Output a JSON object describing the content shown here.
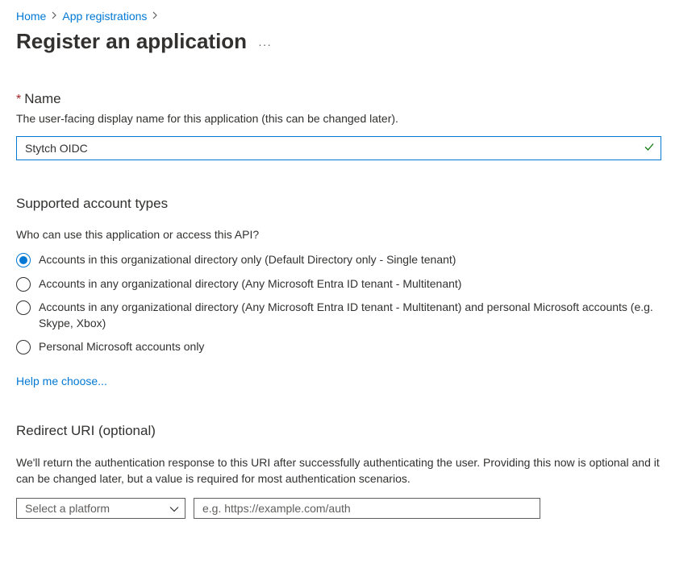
{
  "breadcrumb": {
    "items": [
      "Home",
      "App registrations"
    ]
  },
  "header": {
    "title": "Register an application"
  },
  "name_section": {
    "label": "Name",
    "hint": "The user-facing display name for this application (this can be changed later).",
    "value": "Stytch OIDC"
  },
  "account_types": {
    "heading": "Supported account types",
    "question": "Who can use this application or access this API?",
    "options": [
      "Accounts in this organizational directory only (Default Directory only - Single tenant)",
      "Accounts in any organizational directory (Any Microsoft Entra ID tenant - Multitenant)",
      "Accounts in any organizational directory (Any Microsoft Entra ID tenant - Multitenant) and personal Microsoft accounts (e.g. Skype, Xbox)",
      "Personal Microsoft accounts only"
    ],
    "selected_index": 0,
    "help_link": "Help me choose..."
  },
  "redirect": {
    "heading": "Redirect URI (optional)",
    "description": "We'll return the authentication response to this URI after successfully authenticating the user. Providing this now is optional and it can be changed later, but a value is required for most authentication scenarios.",
    "platform_placeholder": "Select a platform",
    "uri_placeholder": "e.g. https://example.com/auth"
  }
}
